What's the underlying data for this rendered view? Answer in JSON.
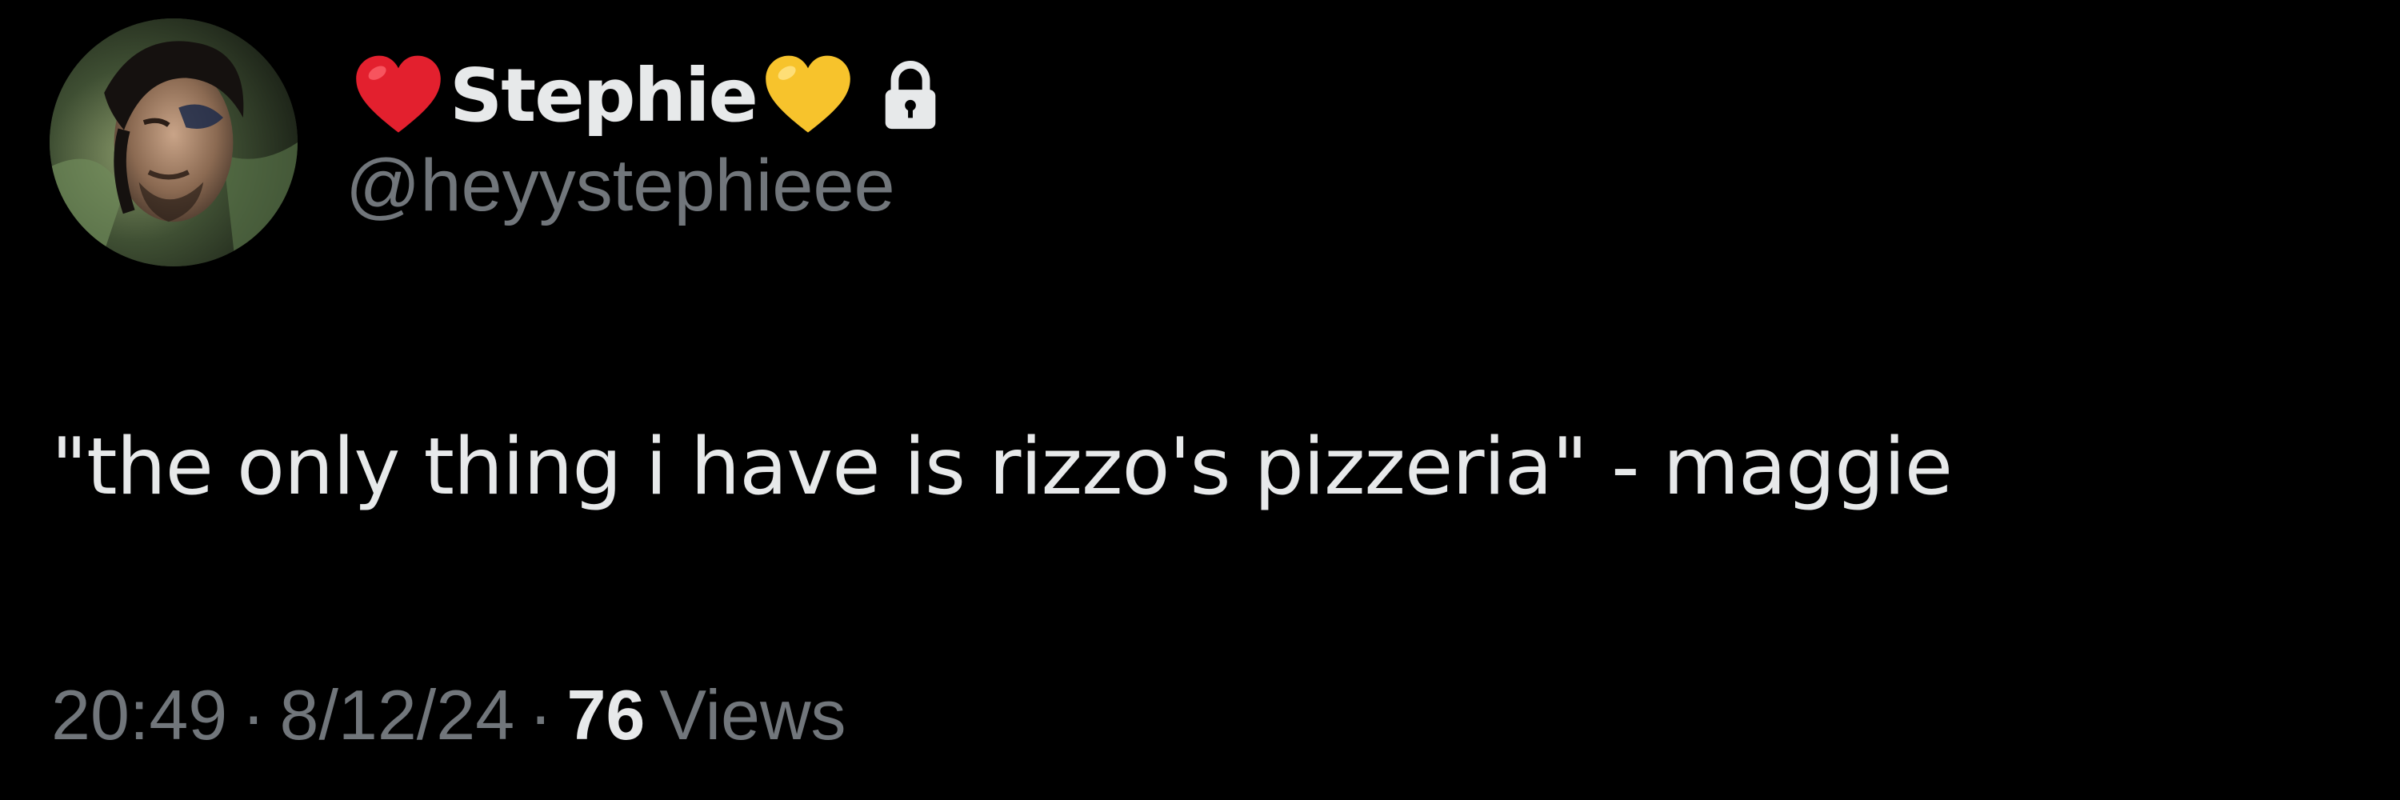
{
  "tweet": {
    "author": {
      "display_name": "Stephie",
      "name_prefix_emoji": "red-heart-emoji",
      "name_suffix_emoji": "yellow-heart-emoji",
      "protected_icon": "lock-icon",
      "handle": "@heyystephieee",
      "avatar": "avatar-photo"
    },
    "text": "\"the only thing i have is rizzo's pizzeria\" - maggie",
    "meta": {
      "time": "20:49",
      "separator": "·",
      "date": "8/12/24",
      "views_count": "76",
      "views_label": "Views"
    }
  },
  "colors": {
    "background": "#000000",
    "primary_text": "#e7e9ea",
    "secondary_text": "#71767b",
    "red_heart": "#e3202e",
    "yellow_heart": "#f7c32c"
  }
}
